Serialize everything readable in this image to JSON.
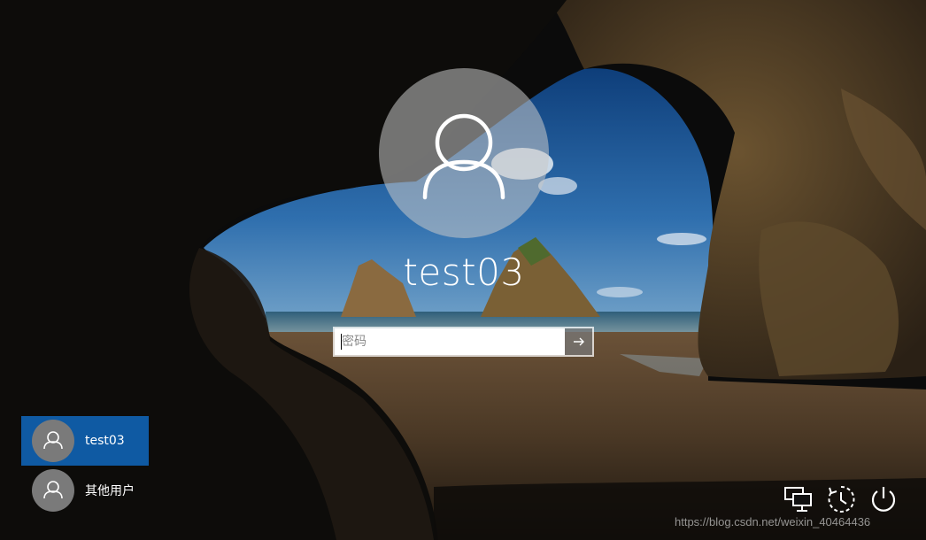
{
  "login": {
    "username": "test03",
    "password_placeholder": "密码"
  },
  "users": [
    {
      "name": "test03",
      "selected": true
    },
    {
      "name": "其他用户",
      "selected": false
    }
  ],
  "system_icons": [
    "network-icon",
    "ease-of-access-icon",
    "power-icon"
  ],
  "watermark": "https://blog.csdn.net/weixin_40464436",
  "colors": {
    "selected_user_bg": "#0f5aa3",
    "avatar_bg": "#7a7a7a",
    "submit_bg": "#787878"
  }
}
